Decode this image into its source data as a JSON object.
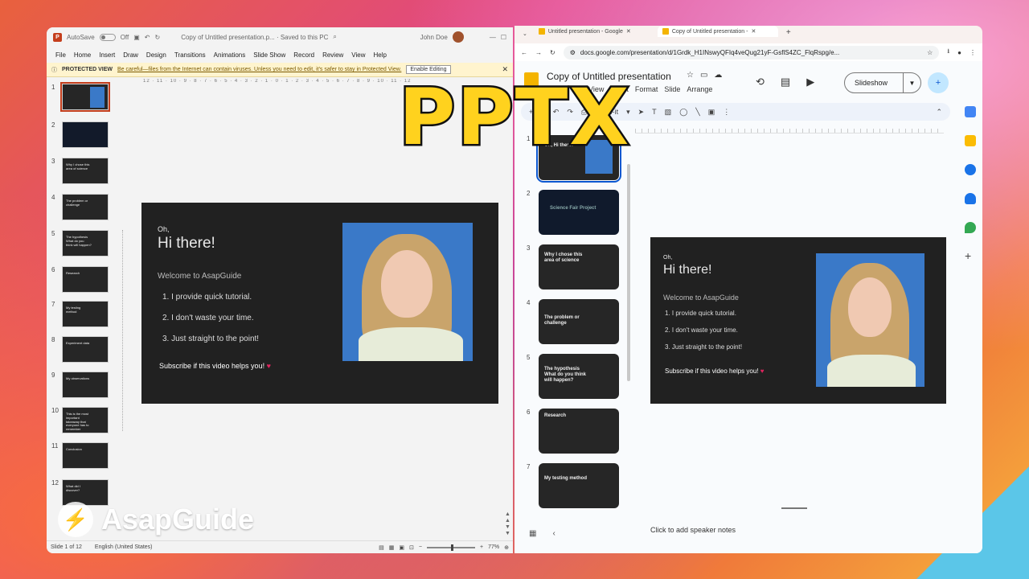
{
  "overlay": {
    "big_label": "PPTX",
    "brand": "AsapGuide"
  },
  "ppt": {
    "autosave_label": "AutoSave",
    "autosave_state": "Off",
    "title": "Copy of Untitled presentation.p... · Saved to this PC",
    "user": "John Doe",
    "menu": [
      "File",
      "Home",
      "Insert",
      "Draw",
      "Design",
      "Transitions",
      "Animations",
      "Slide Show",
      "Record",
      "Review",
      "View",
      "Help"
    ],
    "protected": {
      "label": "PROTECTED VIEW",
      "message": "Be careful—files from the Internet can contain viruses. Unless you need to edit, it's safer to stay in Protected View.",
      "button": "Enable Editing"
    },
    "ruler": "12 · 11 · 10 · 9 · 8 · 7 · 6 · 5 · 4 · 3 · 2 · 1 · 0 · 1 · 2 · 3 · 4 · 5 · 6 · 7 · 8 · 9 · 10 · 11 · 12",
    "thumbs": [
      {
        "num": "1",
        "text": ""
      },
      {
        "num": "2",
        "text": ""
      },
      {
        "num": "3",
        "text": "Why I chose this area of science"
      },
      {
        "num": "4",
        "text": "The problem or challenge"
      },
      {
        "num": "5",
        "text": "The hypothesis What do you think will happen?"
      },
      {
        "num": "6",
        "text": "Research"
      },
      {
        "num": "7",
        "text": "My testing method"
      },
      {
        "num": "8",
        "text": "Experiment data"
      },
      {
        "num": "9",
        "text": "My observations"
      },
      {
        "num": "10",
        "text": "This is the most important takeaway that everyone has to remember"
      },
      {
        "num": "11",
        "text": "Conclusion"
      },
      {
        "num": "12",
        "text": "What did I discover?"
      }
    ],
    "status": {
      "slide": "Slide 1 of 12",
      "language": "English (United States)",
      "zoom": "77%"
    }
  },
  "slide": {
    "oh": "Oh,",
    "hi": "Hi there!",
    "welcome": "Welcome to AsapGuide",
    "items": [
      "1.   I provide quick tutorial.",
      "2.   I don't waste your time.",
      "3.   Just straight to the point!"
    ],
    "subscribe": "Subscribe if this video helps you!",
    "heart": "♥"
  },
  "chrome": {
    "tabs": [
      {
        "label": "Untitled presentation - Google"
      },
      {
        "label": "Copy of Untitled presentation -"
      }
    ],
    "new_tab": "+",
    "url": "docs.google.com/presentation/d/1Grdk_H1INswyQFIq4veQug21yF-GsflS4ZC_FlqRspg/e..."
  },
  "slides_app": {
    "doc_title": "Copy of Untitled presentation",
    "menu": [
      "View",
      "Insert",
      "Format",
      "Slide",
      "Arrange"
    ],
    "slideshow": "Slideshow",
    "zoom": "Fit",
    "notes": "Click to add speaker notes",
    "thumbs": [
      {
        "num": "1",
        "text": "Oh, Hi there!"
      },
      {
        "num": "2",
        "text": "Science Fair Project"
      },
      {
        "num": "3",
        "text": "Why I chose this area of science"
      },
      {
        "num": "4",
        "text": "The problem or challenge"
      },
      {
        "num": "5",
        "text": "The hypothesis What do you think will happen?"
      },
      {
        "num": "6",
        "text": "Research"
      },
      {
        "num": "7",
        "text": "My testing method"
      }
    ]
  }
}
